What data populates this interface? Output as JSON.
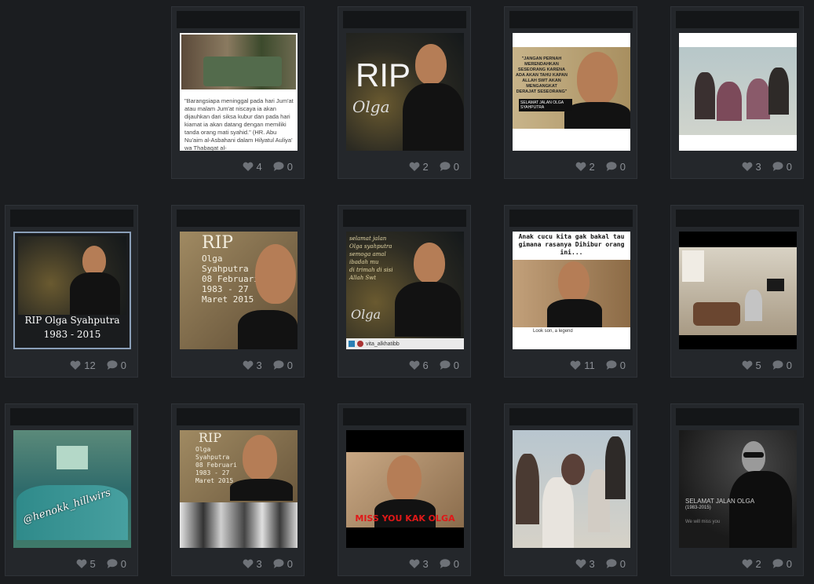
{
  "cards": [
    {
      "likes": "4",
      "comments": "0",
      "quote": "\"Barangsiapa meninggal pada hari Jum'at atau malam Jum'at niscaya ia akan dijauhkan dari siksa kubur dan pada hari kiamat ia akan datang dengan memiliki tanda orang mati syahid.\" (HR. Abu Nu'aim al-Asbahani dalam Hilyatul Auliya' wa Thabaqat al-"
    },
    {
      "likes": "2",
      "comments": "0",
      "rip": "RIP",
      "name": "Olga"
    },
    {
      "likes": "2",
      "comments": "0",
      "quote": "\"JANGAN PERNAH MERENDAHKAN SESEORANG KARENA ADA AKAN TAHU KAPAN ALLAH SWT AKAN MENGANGKAT DERAJAT SESEORANG\"",
      "name": "SELAMAT JALAN OLGA SYAHPUTRA"
    },
    {
      "likes": "3",
      "comments": "0"
    },
    {
      "likes": "12",
      "comments": "0",
      "caption": "RIP Olga Syahputra",
      "years": "1983 - 2015"
    },
    {
      "likes": "3",
      "comments": "0",
      "rip": "RIP",
      "lines": [
        "Olga",
        "Syahputra",
        "08 Februari",
        "1983 - 27",
        "Maret 2015"
      ]
    },
    {
      "likes": "6",
      "comments": "0",
      "lines": [
        "selamat jalan",
        "Olga syahputra",
        "semoga amal",
        "ibadah mu",
        "di trimah di sisi",
        "Allah Swt"
      ],
      "name": "Olga",
      "user": "vita_alkhatibb"
    },
    {
      "likes": "11",
      "comments": "0",
      "caption": "Anak cucu kita gak bakal tau gimana rasanya Dihibur orang ini...",
      "bottom": "Look son, a legend"
    },
    {
      "likes": "5",
      "comments": "0"
    },
    {
      "likes": "5",
      "comments": "0",
      "caption": "@henokk_hillwirs"
    },
    {
      "likes": "3",
      "comments": "0",
      "rip": "RIP",
      "lines": [
        "Olga",
        "Syahputra",
        "08 Februari",
        "1983 - 27",
        "Maret 2015"
      ]
    },
    {
      "likes": "3",
      "comments": "0",
      "caption": "MISS YOU KAK OLGA"
    },
    {
      "likes": "3",
      "comments": "0"
    },
    {
      "likes": "2",
      "comments": "0",
      "caption": "SELAMAT JALAN OLGA",
      "years": "(1983-2015)",
      "sub": "We will miss you"
    }
  ],
  "icons": {
    "like": "heart-icon",
    "comment": "comment-icon"
  }
}
